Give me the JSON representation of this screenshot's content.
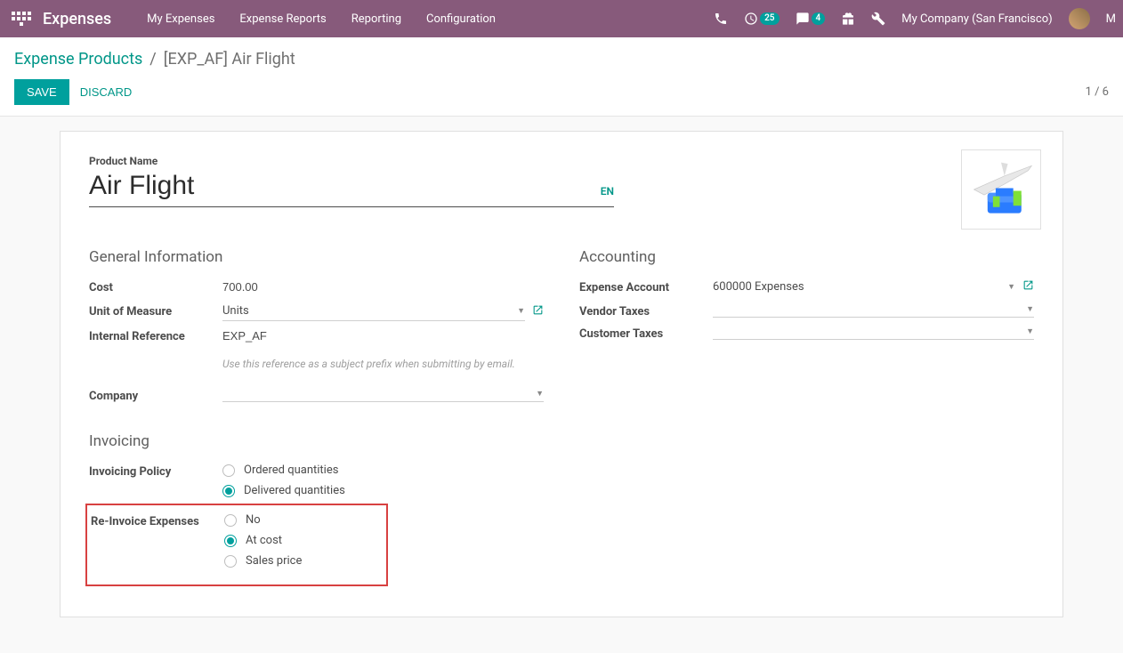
{
  "nav": {
    "title": "Expenses",
    "menu": [
      "My Expenses",
      "Expense Reports",
      "Reporting",
      "Configuration"
    ],
    "badge_activities": "25",
    "badge_messages": "4",
    "company": "My Company (San Francisco)",
    "user_initial": "M"
  },
  "breadcrumb": {
    "root": "Expense Products",
    "current": "[EXP_AF] Air Flight"
  },
  "buttons": {
    "save": "SAVE",
    "discard": "DISCARD"
  },
  "pager": "1 / 6",
  "title": {
    "label": "Product Name",
    "value": "Air Flight",
    "lang": "EN"
  },
  "sections": {
    "general": "General Information",
    "accounting": "Accounting",
    "invoicing": "Invoicing"
  },
  "fields": {
    "cost_label": "Cost",
    "cost_value": "700.00",
    "uom_label": "Unit of Measure",
    "uom_value": "Units",
    "ref_label": "Internal Reference",
    "ref_value": "EXP_AF",
    "ref_hint": "Use this reference as a subject prefix when submitting by email.",
    "company_label": "Company",
    "company_value": "",
    "expense_acct_label": "Expense Account",
    "expense_acct_value": "600000 Expenses",
    "vendor_tax_label": "Vendor Taxes",
    "vendor_tax_value": "",
    "customer_tax_label": "Customer Taxes",
    "customer_tax_value": ""
  },
  "invoicing": {
    "policy_label": "Invoicing Policy",
    "policy_options": [
      "Ordered quantities",
      "Delivered quantities"
    ],
    "policy_selected": 1,
    "reinvoice_label": "Re-Invoice Expenses",
    "reinvoice_options": [
      "No",
      "At cost",
      "Sales price"
    ],
    "reinvoice_selected": 1
  }
}
